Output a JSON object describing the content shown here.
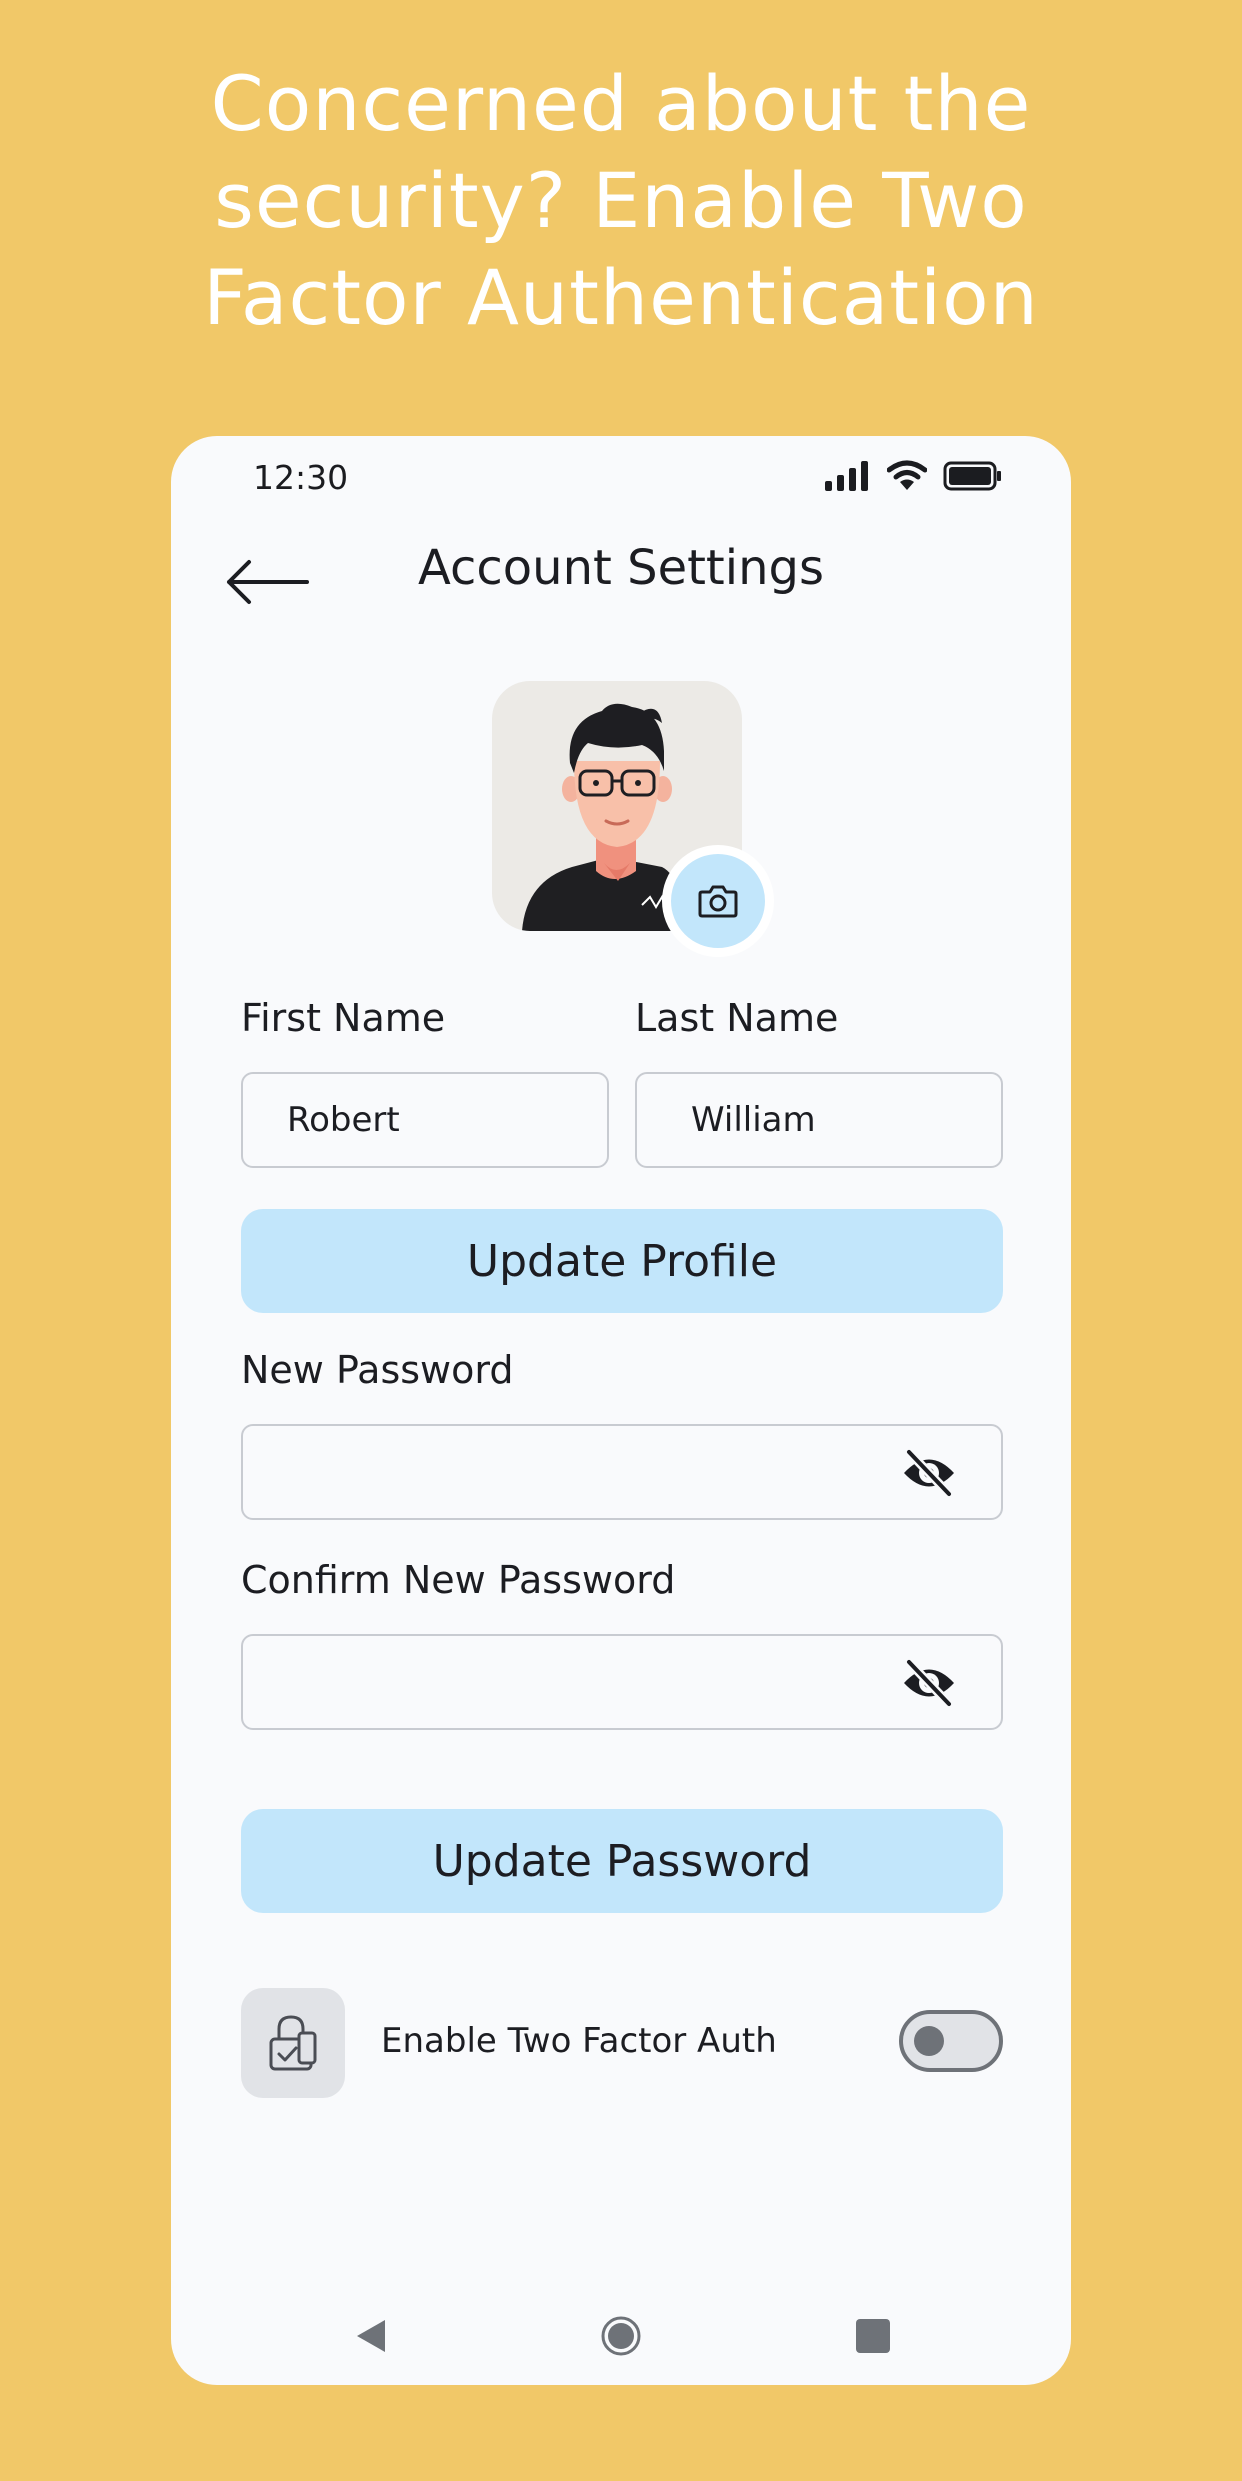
{
  "headline": {
    "line1": "Concerned about the",
    "line2": "security? Enable Two",
    "line3": "Factor Authentication"
  },
  "colors": {
    "background": "#F1C868",
    "phone_surface": "#F9FAFC",
    "accent_button": "#C2E6FB",
    "text": "#1C1D22",
    "field_border": "#C8CBD1"
  },
  "status_bar": {
    "time": "12:30",
    "icons": [
      "signal-icon",
      "wifi-icon",
      "battery-icon"
    ]
  },
  "header": {
    "title": "Account Settings",
    "back_icon": "arrow-left-icon"
  },
  "profile": {
    "avatar": "user-avatar-illustration",
    "camera_icon": "camera-icon"
  },
  "form": {
    "first_name_label": "First Name",
    "first_name_value": "Robert",
    "last_name_label": "Last Name",
    "last_name_value": "William",
    "update_profile_label": "Update Profile",
    "new_password_label": "New Password",
    "new_password_value": "",
    "confirm_password_label": "Confirm New Password",
    "confirm_password_value": "",
    "eye_icon": "eye-off-icon",
    "update_password_label": "Update Password"
  },
  "two_factor": {
    "label": "Enable Two Factor Auth",
    "icon": "lock-check-icon",
    "enabled": false
  },
  "nav_bar": {
    "icons": [
      "back-triangle-icon",
      "home-circle-icon",
      "recents-square-icon"
    ]
  }
}
